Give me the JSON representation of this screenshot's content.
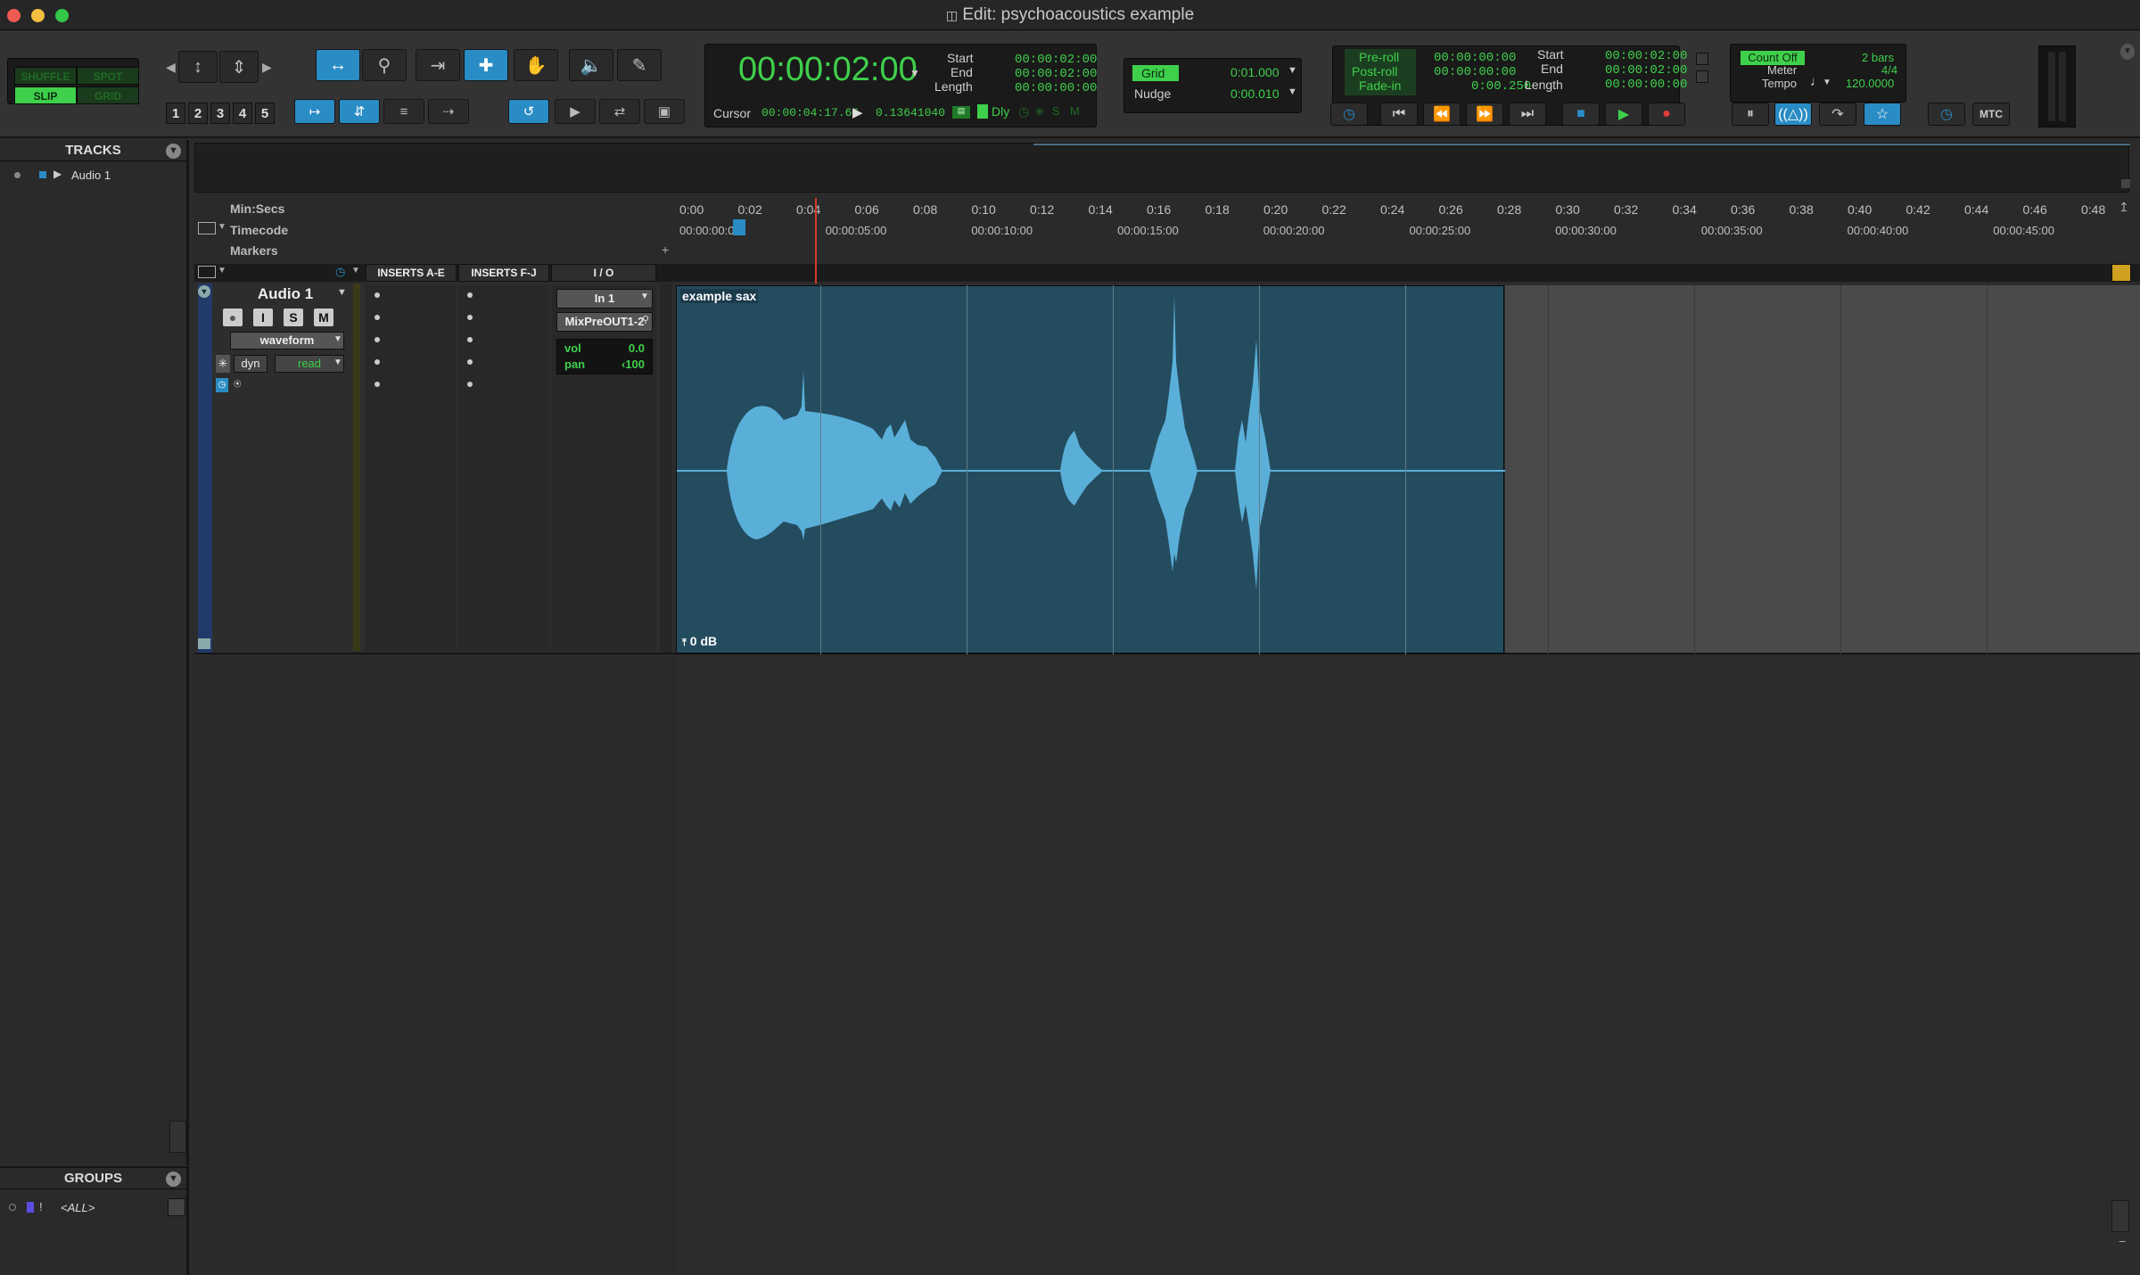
{
  "window": {
    "title": "Edit: psychoacoustics example"
  },
  "edit_modes": {
    "shuffle": "SHUFFLE",
    "spot": "SPOT",
    "slip": "SLIP",
    "grid": "GRID"
  },
  "zoom_presets": [
    "1",
    "2",
    "3",
    "4",
    "5"
  ],
  "counter": {
    "main": "00:00:02:00",
    "start_label": "Start",
    "start": "00:00:02:00",
    "end_label": "End",
    "end": "00:00:02:00",
    "length_label": "Length",
    "length": "00:00:00:00",
    "cursor_label": "Cursor",
    "cursor": "00:00:04:17.66",
    "cursor_value": "0.13641040",
    "dly": "Dly"
  },
  "grid": {
    "label": "Grid",
    "value": "0:01.000",
    "nudge_label": "Nudge",
    "nudge_value": "0:00.010"
  },
  "transport": {
    "preroll_label": "Pre-roll",
    "preroll": "00:00:00:00",
    "postroll_label": "Post-roll",
    "postroll": "00:00:00:00",
    "fadein_label": "Fade-in",
    "fadein": "0:00.250",
    "start_label": "Start",
    "start": "00:00:02:00",
    "end_label": "End",
    "end": "00:00:02:00",
    "length_label": "Length",
    "length": "00:00:00:00"
  },
  "midi": {
    "countoff_label": "Count Off",
    "countoff": "2 bars",
    "meter_label": "Meter",
    "meter": "4/4",
    "tempo_label": "Tempo",
    "tempo": "120.0000",
    "mtc": "MTC"
  },
  "tracks_panel": {
    "title": "TRACKS",
    "items": [
      {
        "name": "Audio 1"
      }
    ]
  },
  "groups_panel": {
    "title": "GROUPS",
    "items": [
      {
        "name": "<ALL>"
      }
    ]
  },
  "rulers": {
    "minsecs_label": "Min:Secs",
    "timecode_label": "Timecode",
    "markers_label": "Markers",
    "minsecs_ticks": [
      "0:00",
      "0:02",
      "0:04",
      "0:06",
      "0:08",
      "0:10",
      "0:12",
      "0:14",
      "0:16",
      "0:18",
      "0:20",
      "0:22",
      "0:24",
      "0:26",
      "0:28",
      "0:30",
      "0:32",
      "0:34",
      "0:36",
      "0:38",
      "0:40",
      "0:42",
      "0:44",
      "0:46",
      "0:48"
    ],
    "timecode_ticks": [
      "00:00:00:00",
      "00:00:05:00",
      "00:00:10:00",
      "00:00:15:00",
      "00:00:20:00",
      "00:00:25:00",
      "00:00:30:00",
      "00:00:35:00",
      "00:00:40:00",
      "00:00:45:00"
    ]
  },
  "columns": {
    "inserts_ae": "INSERTS A-E",
    "inserts_fj": "INSERTS F-J",
    "io": "I / O"
  },
  "track": {
    "name": "Audio 1",
    "rec": "●",
    "input": "I",
    "solo": "S",
    "mute": "M",
    "view": "waveform",
    "dyn": "dyn",
    "automation": "read",
    "input_assign": "In 1",
    "output_assign": "MixPreOUT1-2",
    "vol_label": "vol",
    "vol": "0.0",
    "pan_label": "pan",
    "pan": "‹100"
  },
  "clip": {
    "name": "example sax",
    "gain": "0 dB"
  },
  "colors": {
    "accent": "#2a8cc4",
    "green": "#3fd04b",
    "clip_bg": "#244c5f",
    "waveform": "#5aafd9",
    "playhead": "#d23a2a"
  }
}
